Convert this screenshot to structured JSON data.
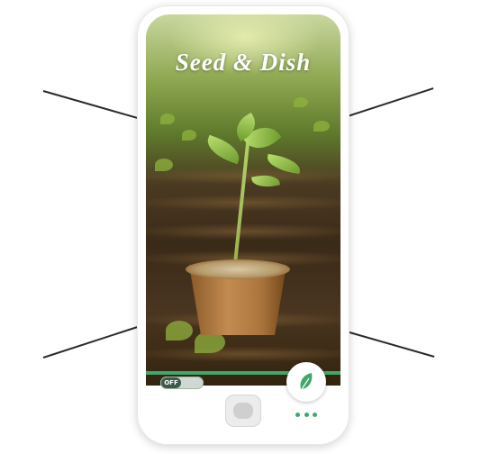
{
  "app": {
    "title": "Seed & Dish"
  },
  "controls": {
    "toggle_label": "OFF"
  },
  "icons": {
    "fab_icon": "leaf-icon",
    "home_icon": "home-button-icon",
    "more_icon": "more-dots-icon"
  },
  "colors": {
    "accent": "#3fa86a",
    "title_text": "#ffffff",
    "toggle_knob": "#3d5a4a"
  }
}
